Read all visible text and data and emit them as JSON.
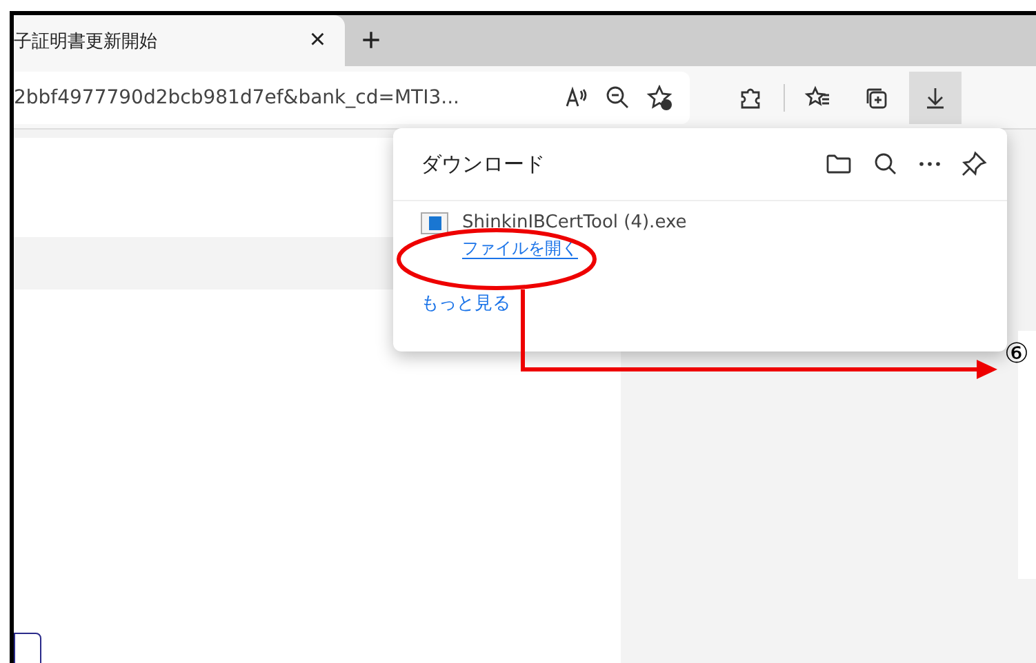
{
  "tab": {
    "title": "子証明書更新開始",
    "close": "×",
    "new_tab": "+"
  },
  "address_bar": {
    "url": "2bbf4977790d2bcb981d7ef&bank_cd=MTI3..."
  },
  "downloads_panel": {
    "title": "ダウンロード",
    "items": [
      {
        "file_name": "ShinkinIBCertTool (4).exe",
        "action": "ファイルを開く"
      }
    ],
    "more_link": "もっと見る"
  },
  "annotation": {
    "step_label": "⑥"
  }
}
